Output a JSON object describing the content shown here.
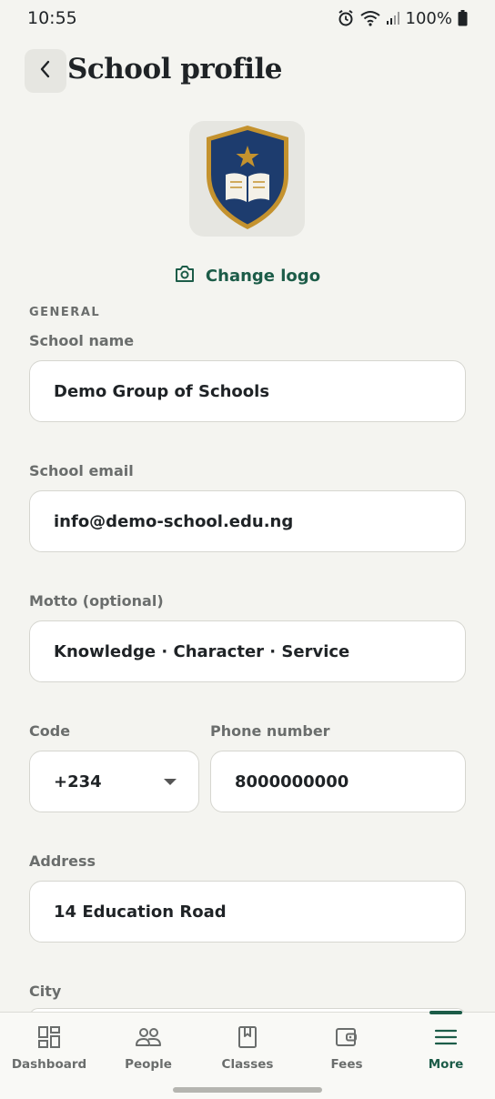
{
  "status_bar": {
    "time": "10:55",
    "battery": "100%"
  },
  "header": {
    "title": "School profile"
  },
  "logo": {
    "change_label": "Change logo"
  },
  "form": {
    "section_general": "GENERAL",
    "school_name": {
      "label": "School name",
      "value": "Demo Group of Schools"
    },
    "school_email": {
      "label": "School email",
      "value": "info@demo-school.edu.ng"
    },
    "motto": {
      "label": "Motto (optional)",
      "value": "Knowledge · Character · Service"
    },
    "code": {
      "label": "Code",
      "value": "+234"
    },
    "phone": {
      "label": "Phone number",
      "value": "8000000000"
    },
    "address": {
      "label": "Address",
      "value": "14 Education Road"
    },
    "city": {
      "label": "City",
      "value": ""
    }
  },
  "bottom_nav": {
    "items": [
      {
        "label": "Dashboard",
        "icon": "dashboard-icon"
      },
      {
        "label": "People",
        "icon": "people-icon"
      },
      {
        "label": "Classes",
        "icon": "book-icon"
      },
      {
        "label": "Fees",
        "icon": "wallet-icon"
      },
      {
        "label": "More",
        "icon": "menu-icon"
      }
    ],
    "active": "More"
  },
  "colors": {
    "accent": "#1c5c48",
    "background": "#f4f4f0",
    "shield_navy": "#1d3c6e",
    "shield_gold": "#c4922e"
  }
}
